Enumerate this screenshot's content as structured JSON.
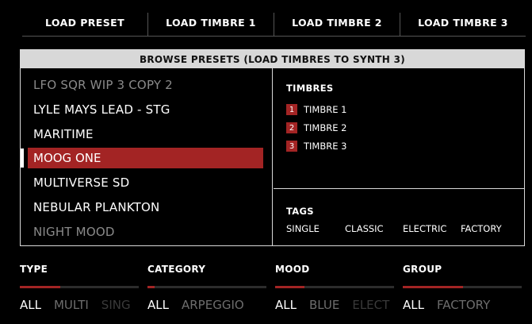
{
  "load_buttons": [
    "LOAD PRESET",
    "LOAD TIMBRE 1",
    "LOAD TIMBRE 2",
    "LOAD TIMBRE 3"
  ],
  "browser": {
    "title": "BROWSE PRESETS (LOAD TIMBRES TO SYNTH 3)",
    "presets": [
      {
        "label": "LFO SQR WIP 3 COPY 2"
      },
      {
        "label": "LYLE MAYS LEAD - STG"
      },
      {
        "label": "MARITIME"
      },
      {
        "label": "MOOG ONE"
      },
      {
        "label": "MULTIVERSE SD"
      },
      {
        "label": "NEBULAR PLANKTON"
      },
      {
        "label": "NIGHT MOOD"
      }
    ],
    "selected_preset": "MOOG ONE",
    "timbres_heading": "TIMBRES",
    "timbres": [
      {
        "num": "1",
        "label": "TIMBRE 1"
      },
      {
        "num": "2",
        "label": "TIMBRE 2"
      },
      {
        "num": "3",
        "label": "TIMBRE 3"
      }
    ],
    "tags_heading": "TAGS",
    "tags": [
      "SINGLE",
      "CLASSIC",
      "ELECTRIC",
      "FACTORY"
    ]
  },
  "filters": [
    {
      "heading": "TYPE",
      "values": [
        "ALL",
        "MULTI",
        "SING"
      ],
      "scroll_thumb_fraction": 0.33
    },
    {
      "heading": "CATEGORY",
      "values": [
        "ALL",
        "ARPEGGIO"
      ],
      "scroll_thumb_fraction": 0.06
    },
    {
      "heading": "MOOD",
      "values": [
        "ALL",
        "BLUE",
        "ELECT"
      ],
      "scroll_thumb_fraction": 0.25
    },
    {
      "heading": "GROUP",
      "values": [
        "ALL",
        "FACTORY"
      ],
      "scroll_thumb_fraction": 0.5
    }
  ],
  "colors": {
    "accent": "#a32424",
    "panel_border": "#d8d8d8",
    "background": "#000000"
  }
}
